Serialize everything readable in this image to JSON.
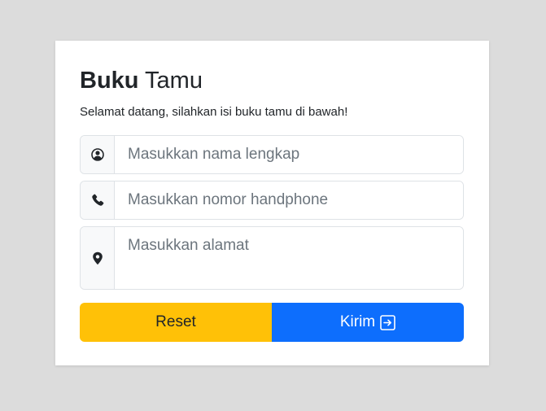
{
  "form": {
    "title_bold": "Buku",
    "title_rest": " Tamu",
    "subtitle": "Selamat datang, silahkan isi buku tamu di bawah!",
    "name": {
      "placeholder": "Masukkan nama lengkap",
      "icon": "user-circle-icon"
    },
    "phone": {
      "placeholder": "Masukkan nomor handphone",
      "icon": "phone-icon"
    },
    "address": {
      "placeholder": "Masukkan alamat",
      "icon": "map-pin-icon"
    },
    "reset_label": "Reset",
    "submit_label": "Kirim",
    "submit_icon": "arrow-right-square-icon"
  },
  "colors": {
    "background": "#dcdcdc",
    "card": "#ffffff",
    "reset": "#ffc107",
    "submit": "#0d6efd",
    "addon": "#f8f9fa",
    "border": "#dee2e6"
  }
}
